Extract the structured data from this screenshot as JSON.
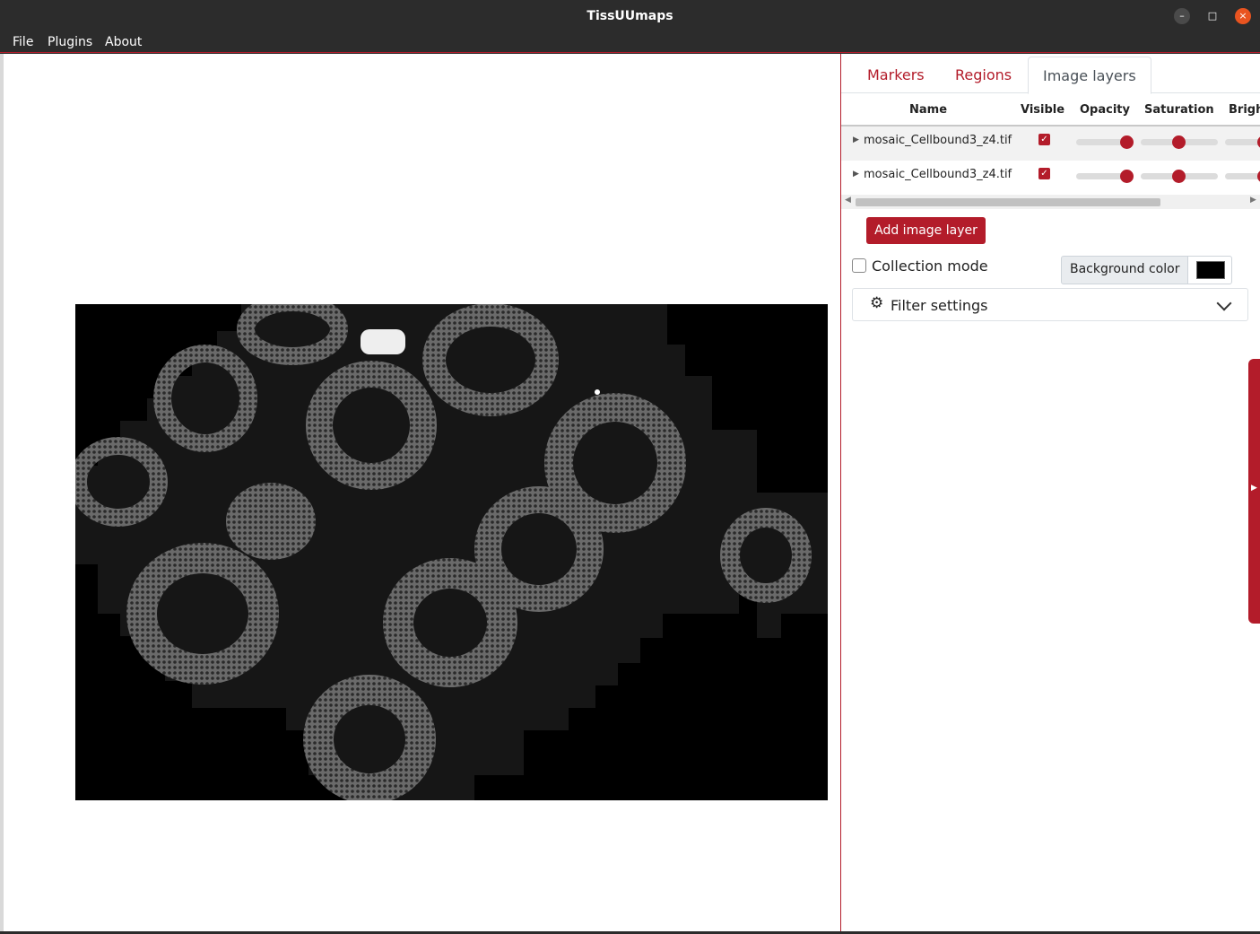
{
  "window": {
    "title": "TissUUmaps",
    "min_icon": "–",
    "max_icon": "□",
    "close_icon": "×"
  },
  "menu": {
    "file": "File",
    "plugins": "Plugins",
    "about": "About"
  },
  "tabs": [
    {
      "label": "Markers"
    },
    {
      "label": "Regions"
    },
    {
      "label": "Image layers"
    }
  ],
  "layers_table": {
    "headers": [
      "Name",
      "Visible",
      "Opacity",
      "Saturation",
      "Brigh"
    ],
    "rows": [
      {
        "name": "mosaic_Cellbound3_z4.tif",
        "visible": true,
        "opacity": 0.8,
        "saturation": 0.5
      },
      {
        "name": "mosaic_Cellbound3_z4.tif",
        "visible": true,
        "opacity": 0.8,
        "saturation": 0.5
      }
    ]
  },
  "controls": {
    "add_layer": "Add image layer",
    "collection_mode": "Collection mode",
    "background_color_label": "Background color",
    "background_color": "#000000",
    "filter_settings": "Filter settings",
    "check_mark": "✓"
  },
  "colors": {
    "accent": "#b31c2a"
  }
}
